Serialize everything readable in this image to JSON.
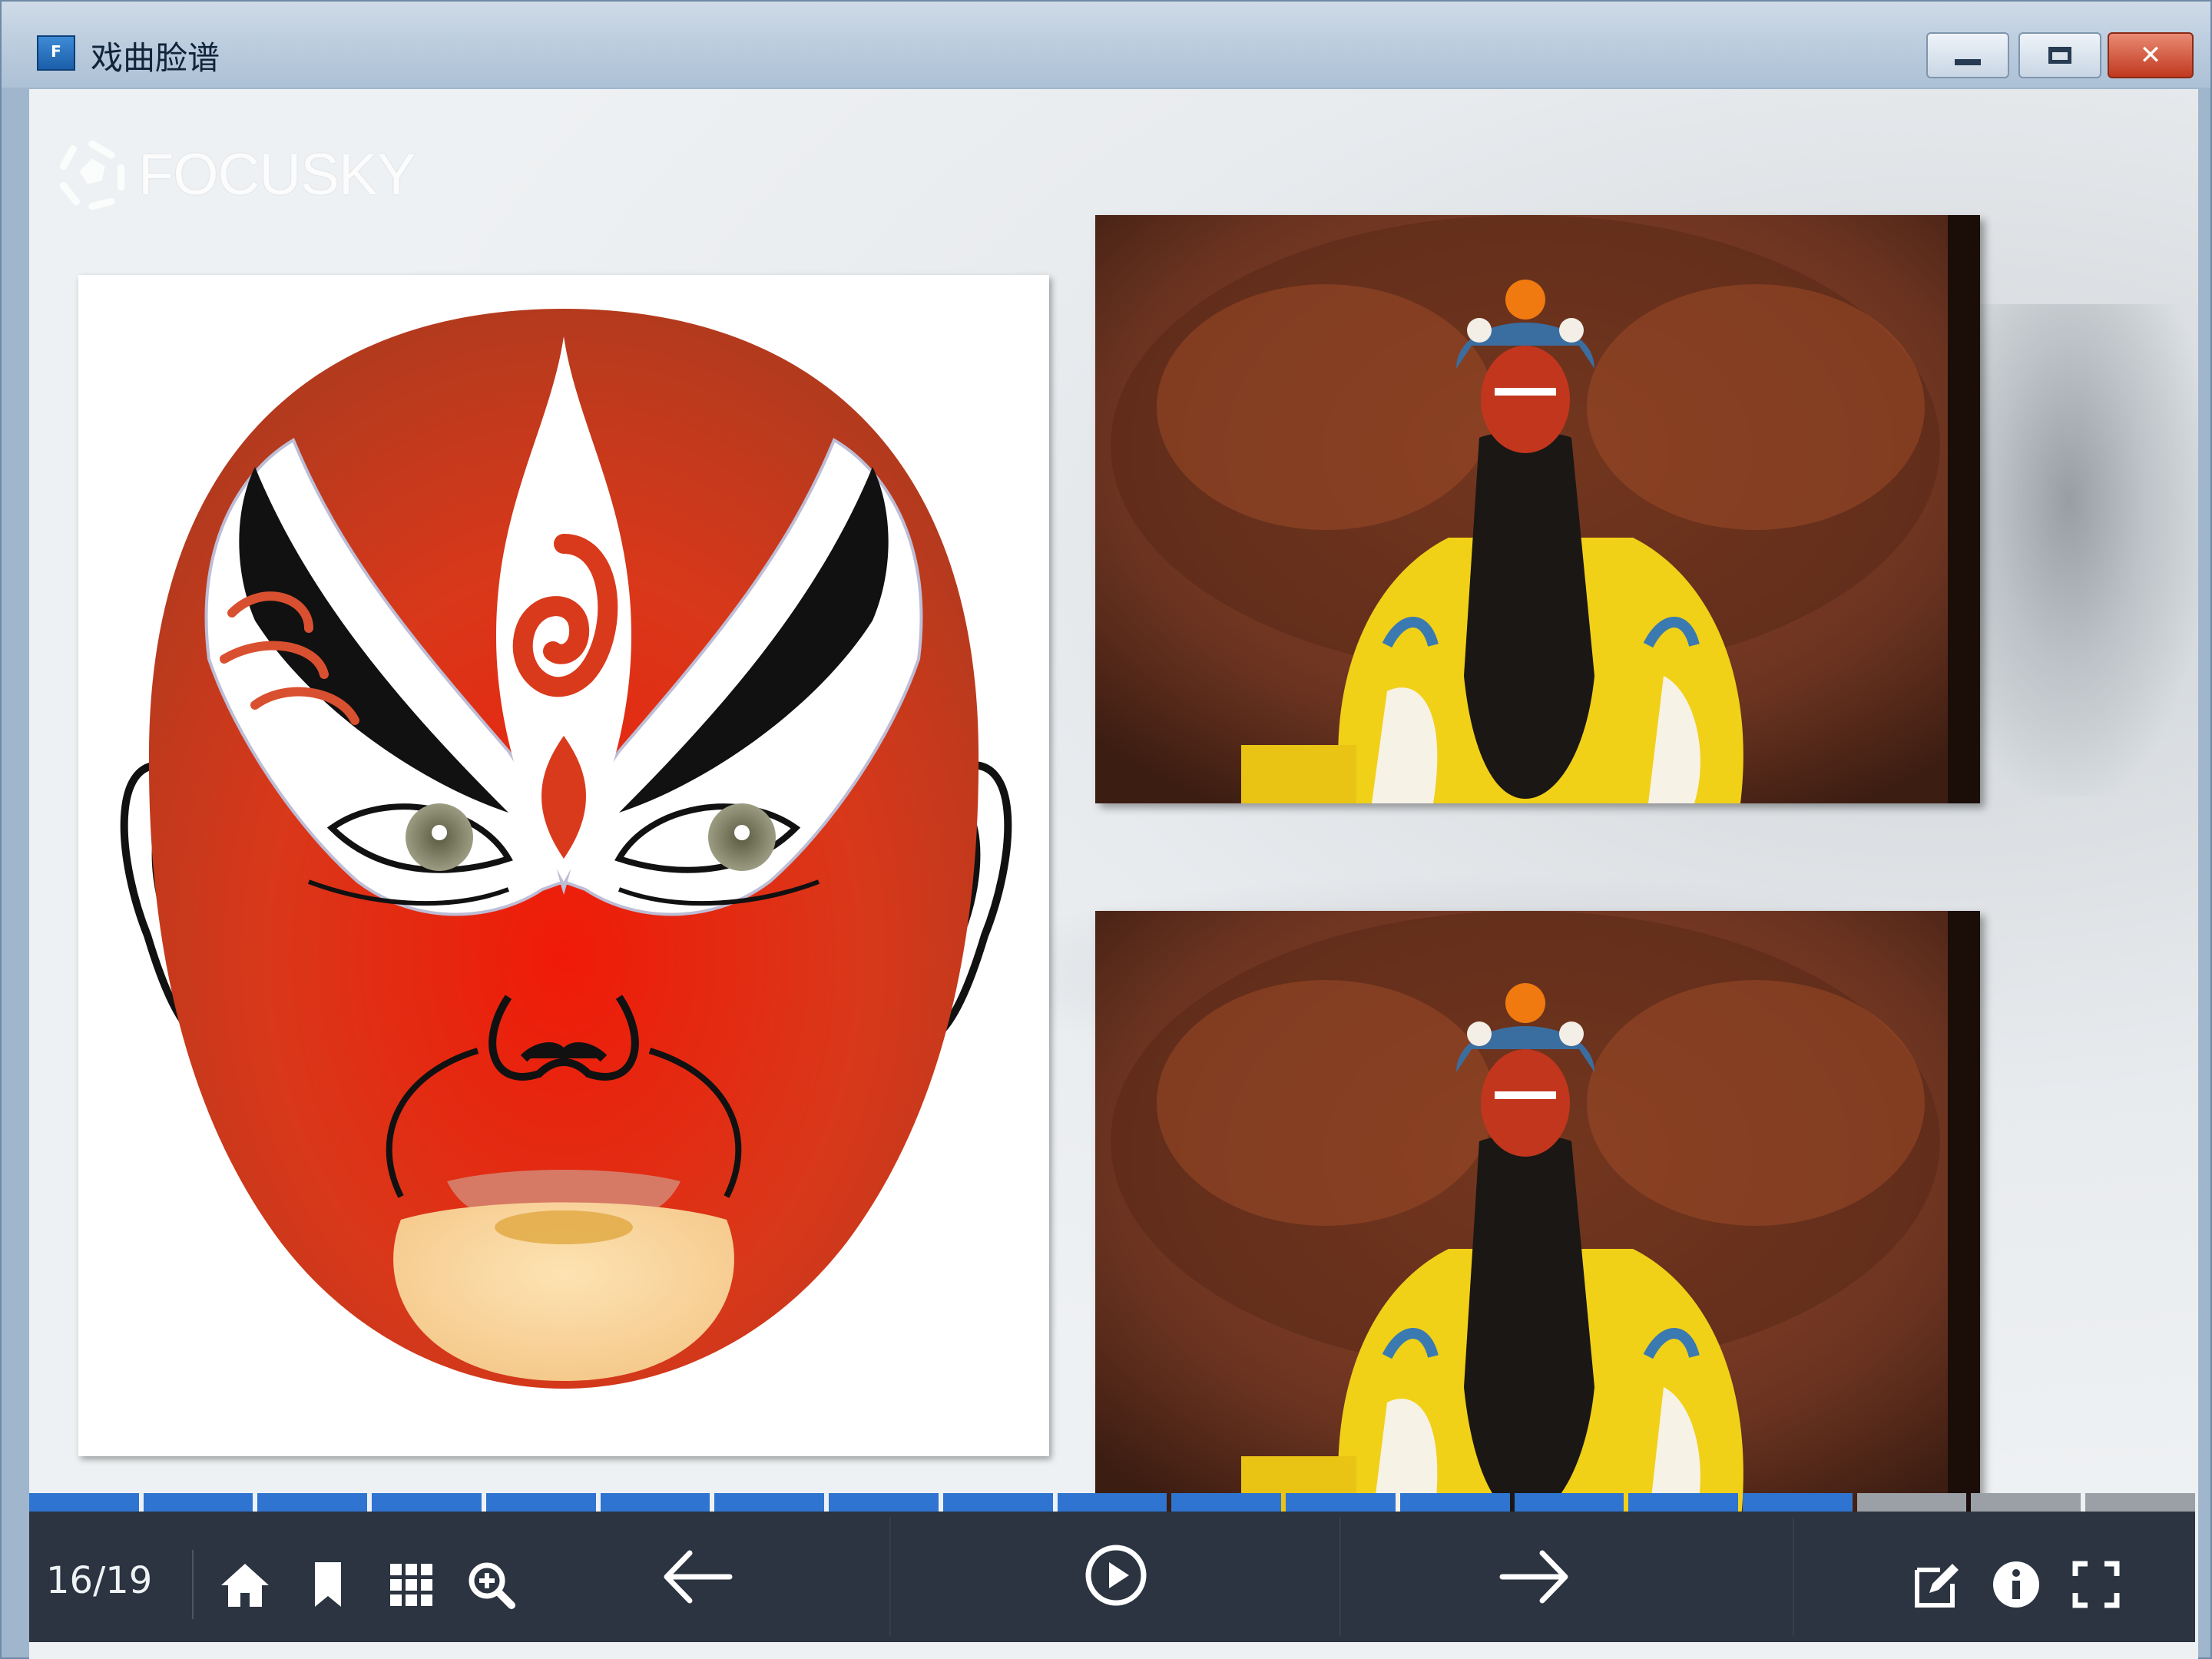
{
  "window": {
    "title": "戏曲脸谱",
    "app_icon": "focusky-app-icon",
    "controls": [
      "minimize-icon",
      "maximize-icon",
      "close-icon"
    ]
  },
  "brand": {
    "logo_text": "FOCUSKY",
    "logo_icon": "focusky-logo-icon"
  },
  "slide": {
    "images": [
      {
        "name": "peking-opera-red-face-mask",
        "description_icon": "mask-illustration"
      },
      {
        "name": "opera-performer-photo-1"
      },
      {
        "name": "opera-performer-photo-2"
      }
    ]
  },
  "toolbar": {
    "page_indicator": "16/19",
    "current_page": 16,
    "total_pages": 19,
    "left_icons": [
      "home-icon",
      "bookmark-icon",
      "grid-icon",
      "zoom-in-icon"
    ],
    "center_icons": [
      "arrow-left-icon",
      "play-icon",
      "arrow-right-icon"
    ],
    "right_icons": [
      "edit-icon",
      "info-icon",
      "fullscreen-icon"
    ]
  },
  "colors": {
    "toolbar_bg": "#2b3440",
    "progress_done": "#2f74d0",
    "progress_todo": "#9aa0a6",
    "mask_red": "#d93a1c"
  }
}
